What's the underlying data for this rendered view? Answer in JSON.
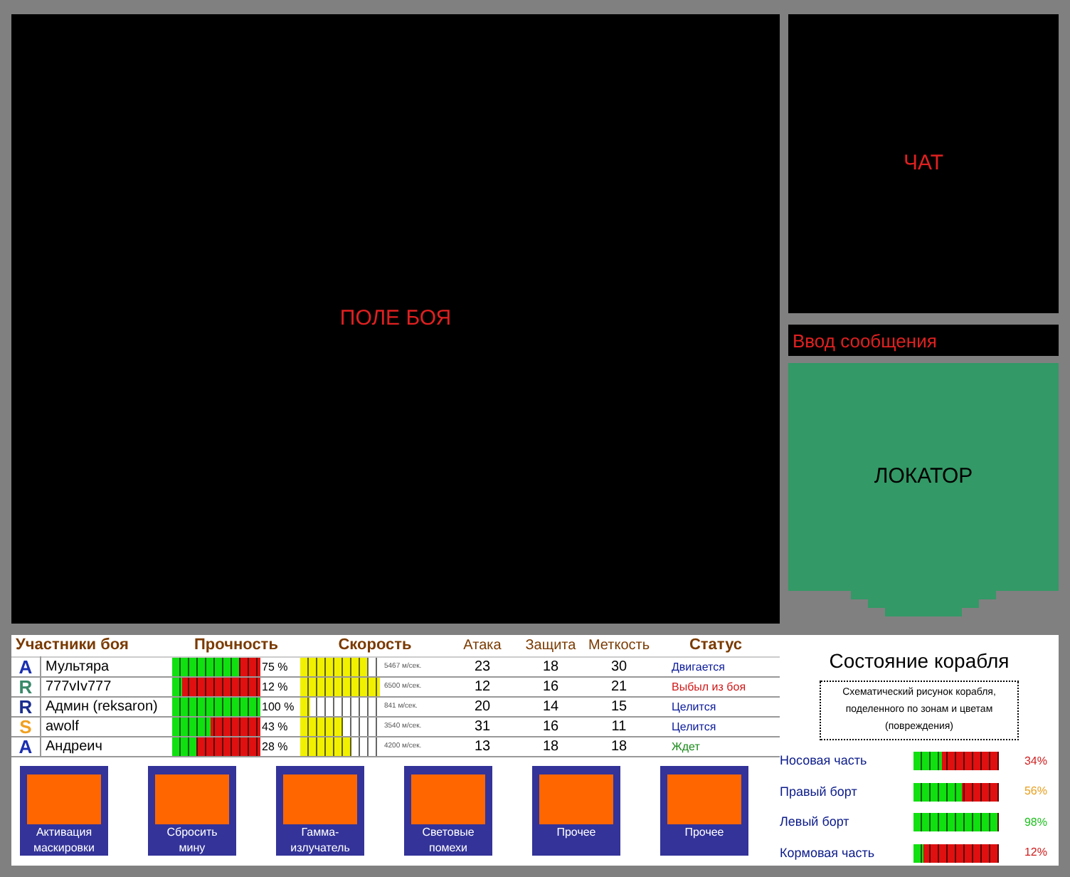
{
  "battlefield": {
    "label": "ПОЛЕ БОЯ"
  },
  "chat": {
    "label": "ЧАТ"
  },
  "message_input": {
    "placeholder": "Ввод сообщения"
  },
  "locator": {
    "label": "ЛОКАТОР"
  },
  "participants": {
    "columns": [
      "Участники боя",
      "Прочность",
      "Скорость",
      "Атака",
      "Защита",
      "Меткость",
      "Статус"
    ],
    "rows": [
      {
        "class": {
          "label": "A",
          "color": "#1a2fb0"
        },
        "name": "Мультяра",
        "durability": {
          "level": 0.75,
          "reading": "75 %"
        },
        "speed": {
          "level": 0.84,
          "reading": "5467 м/сек."
        },
        "attack": "23",
        "defense": "18",
        "accuracy": "30",
        "status": {
          "label": "Двигается",
          "color": "#0a1a9a"
        }
      },
      {
        "class": {
          "label": "R",
          "color": "#3a8a6a"
        },
        "name": "777vIv777",
        "durability": {
          "level": 0.12,
          "reading": "12 %"
        },
        "speed": {
          "level": 1.0,
          "reading": "6500 м/сек."
        },
        "attack": "12",
        "defense": "16",
        "accuracy": "21",
        "status": {
          "label": "Выбыл из боя",
          "color": "#d01818"
        }
      },
      {
        "class": {
          "label": "R",
          "color": "#1a2f90"
        },
        "name": "Админ (reksaron)",
        "durability": {
          "level": 1.0,
          "reading": "100 %"
        },
        "speed": {
          "level": 0.13,
          "reading": "841 м/сек."
        },
        "attack": "20",
        "defense": "14",
        "accuracy": "15",
        "status": {
          "label": "Целится",
          "color": "#0a1a9a"
        }
      },
      {
        "class": {
          "label": "S",
          "color": "#f0a020"
        },
        "name": "awolf",
        "durability": {
          "level": 0.43,
          "reading": "43 %"
        },
        "speed": {
          "level": 0.54,
          "reading": "3540 м/сек."
        },
        "attack": "31",
        "defense": "16",
        "accuracy": "11",
        "status": {
          "label": "Целится",
          "color": "#0a1a9a"
        }
      },
      {
        "class": {
          "label": "A",
          "color": "#1a2fb0"
        },
        "name": "Андреич",
        "durability": {
          "level": 0.28,
          "reading": "28 %"
        },
        "speed": {
          "level": 0.65,
          "reading": "4200 м/сек."
        },
        "attack": "13",
        "defense": "18",
        "accuracy": "18",
        "status": {
          "label": "Ждет",
          "color": "#1a8a1a"
        }
      }
    ]
  },
  "actions": [
    "Активация маскировки",
    "Сбросить мину",
    "Гамма-излучатель",
    "Световые помехи",
    "Прочее",
    "Прочее"
  ],
  "ship_state": {
    "title": "Состояние корабля",
    "schematic": "Схематический рисунок корабля, поделенного по зонам и цветам (повреждения)",
    "zones": [
      {
        "name": "Носовая часть",
        "level": 0.34,
        "reading": "34%",
        "color": "#d02020"
      },
      {
        "name": "Правый борт",
        "level": 0.56,
        "reading": "56%",
        "color": "#e8a020"
      },
      {
        "name": "Левый борт",
        "level": 0.98,
        "reading": "98%",
        "color": "#20c020"
      },
      {
        "name": "Кормовая часть",
        "level": 0.12,
        "reading": "12%",
        "color": "#d02020"
      }
    ]
  }
}
